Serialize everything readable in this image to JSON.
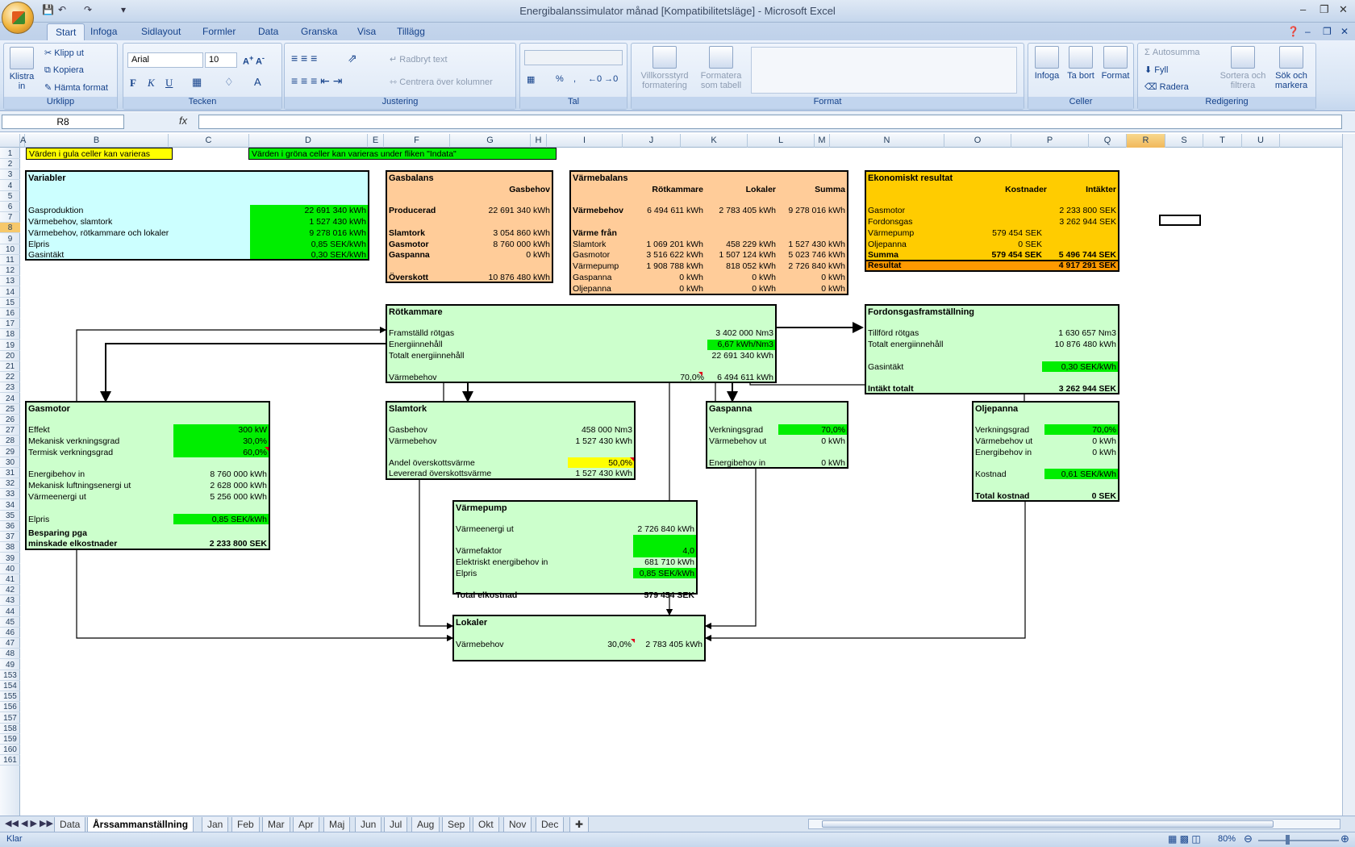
{
  "window": {
    "title": "Energibalanssimulator månad  [Kompatibilitetsläge] - Microsoft Excel"
  },
  "ribbon": {
    "tabs": [
      "Start",
      "Infoga",
      "Sidlayout",
      "Formler",
      "Data",
      "Granska",
      "Visa",
      "Tillägg"
    ],
    "clipboard": {
      "paste": "Klistra in",
      "cut": "Klipp ut",
      "copy": "Kopiera",
      "format_painter": "Hämta format",
      "title": "Urklipp"
    },
    "font": {
      "name": "Arial",
      "size": "10",
      "title": "Tecken",
      "bold": "F",
      "italic": "K",
      "underline": "U"
    },
    "alignment": {
      "wrap": "Radbryt text",
      "merge": "Centrera över kolumner",
      "title": "Justering"
    },
    "number": {
      "title": "Tal",
      "percent": "%"
    },
    "styles": {
      "cond_format": "Villkorsstyrd formatering",
      "format_table": "Formatera som tabell",
      "title": "Format"
    },
    "cells": {
      "insert": "Infoga",
      "delete": "Ta bort",
      "format": "Format",
      "title": "Celler"
    },
    "editing": {
      "autosum": "Autosumma",
      "fill": "Fyll",
      "clear": "Radera",
      "sort": "Sortera och filtrera",
      "find": "Sök och markera",
      "title": "Redigering"
    }
  },
  "formula_bar": {
    "name_box": "R8",
    "fx": "fx",
    "formula": ""
  },
  "columns": [
    "A",
    "B",
    "C",
    "D",
    "E",
    "F",
    "G",
    "H",
    "I",
    "J",
    "K",
    "L",
    "M",
    "N",
    "O",
    "P",
    "Q",
    "R",
    "S",
    "T",
    "U"
  ],
  "rows": [
    "1",
    "2",
    "3",
    "4",
    "5",
    "6",
    "7",
    "8",
    "9",
    "10",
    "11",
    "12",
    "13",
    "14",
    "15",
    "16",
    "17",
    "18",
    "19",
    "20",
    "21",
    "22",
    "23",
    "24",
    "25",
    "26",
    "27",
    "28",
    "29",
    "30",
    "31",
    "32",
    "33",
    "34",
    "35",
    "36",
    "37",
    "38",
    "39",
    "40",
    "41",
    "42",
    "43",
    "44",
    "45",
    "46",
    "47",
    "48",
    "49",
    "153",
    "154",
    "155",
    "156",
    "157",
    "158",
    "159",
    "160",
    "161"
  ],
  "notes": {
    "yellow": "Värden i gula celler kan varieras",
    "green": "Värden i gröna celler kan varieras under fliken \"Indata\""
  },
  "variabler": {
    "title": "Variabler",
    "rows": [
      {
        "label": "Gasproduktion",
        "value": "22 691 340 kWh"
      },
      {
        "label": "Värmebehov, slamtork",
        "value": "1 527 430 kWh"
      },
      {
        "label": "Värmebehov, rötkammare och lokaler",
        "value": "9 278 016 kWh"
      },
      {
        "label": "Elpris",
        "value": "0,85 SEK/kWh"
      },
      {
        "label": "Gasintäkt",
        "value": "0,30 SEK/kWh"
      }
    ]
  },
  "gasbalans": {
    "title": "Gasbalans",
    "col": "Gasbehov",
    "producerad_label": "Producerad",
    "producerad": "22 691 340 kWh",
    "rows": [
      {
        "label": "Slamtork",
        "value": "3 054 860 kWh"
      },
      {
        "label": "Gasmotor",
        "value": "8 760 000 kWh"
      },
      {
        "label": "Gaspanna",
        "value": "0 kWh"
      }
    ],
    "overskott_label": "Överskott",
    "overskott": "10 876 480 kWh"
  },
  "varmebalans": {
    "title": "Värmebalans",
    "cols": [
      "Rötkammare",
      "Lokaler",
      "Summa"
    ],
    "behov": {
      "label": "Värmebehov",
      "values": [
        "6 494 611 kWh",
        "2 783 405 kWh",
        "9 278 016 kWh"
      ]
    },
    "fran_label": "Värme från",
    "rows": [
      {
        "label": "Slamtork",
        "values": [
          "1 069 201 kWh",
          "458 229 kWh",
          "1 527 430 kWh"
        ]
      },
      {
        "label": "Gasmotor",
        "values": [
          "3 516 622 kWh",
          "1 507 124 kWh",
          "5 023 746 kWh"
        ]
      },
      {
        "label": "Värmepump",
        "values": [
          "1 908 788 kWh",
          "818 052 kWh",
          "2 726 840 kWh"
        ]
      },
      {
        "label": "Gaspanna",
        "values": [
          "0 kWh",
          "0 kWh",
          "0 kWh"
        ]
      },
      {
        "label": "Oljepanna",
        "values": [
          "0 kWh",
          "0 kWh",
          "0 kWh"
        ]
      }
    ]
  },
  "ekonomi": {
    "title": "Ekonomiskt resultat",
    "cols": [
      "Kostnader",
      "Intäkter"
    ],
    "rows": [
      {
        "label": "Gasmotor",
        "cost": "",
        "income": "2 233 800 SEK"
      },
      {
        "label": "Fordonsgas",
        "cost": "",
        "income": "3 262 944 SEK"
      },
      {
        "label": "Värmepump",
        "cost": "579 454 SEK",
        "income": ""
      },
      {
        "label": "Oljepanna",
        "cost": "0 SEK",
        "income": ""
      },
      {
        "label": "Summa",
        "cost": "579 454 SEK",
        "income": "5 496 744 SEK"
      }
    ],
    "result_label": "Resultat",
    "result": "4 917 291 SEK"
  },
  "rotkammare": {
    "title": "Rötkammare",
    "rows": [
      {
        "label": "Framställd rötgas",
        "value": "3 402 000 Nm3"
      },
      {
        "label": "Energiinnehåll",
        "value": "6,67 kWh/Nm3"
      },
      {
        "label": "Totalt energiinnehåll",
        "value": "22 691 340 kWh"
      }
    ],
    "behov_label": "Värmebehov",
    "behov_pct": "70,0%",
    "behov": "6 494 611 kWh"
  },
  "fordonsgas": {
    "title": "Fordonsgasframställning",
    "rows": [
      {
        "label": "Tillförd rötgas",
        "value": "1 630 657 Nm3"
      },
      {
        "label": "Totalt energiinnehåll",
        "value": "10 876 480 kWh"
      }
    ],
    "intakt_label": "Gasintäkt",
    "intakt": "0,30 SEK/kWh",
    "total_label": "Intäkt totalt",
    "total": "3 262 944 SEK"
  },
  "gasmotor": {
    "title": "Gasmotor",
    "inputs": [
      {
        "label": "Effekt",
        "value": "300 kW"
      },
      {
        "label": "Mekanisk verkningsgrad",
        "value": "30,0%"
      },
      {
        "label": "Termisk verkningsgrad",
        "value": "60,0%"
      }
    ],
    "rows": [
      {
        "label": "Energibehov in",
        "value": "8 760 000 kWh"
      },
      {
        "label": "Mekanisk luftningsenergi ut",
        "value": "2 628 000 kWh"
      },
      {
        "label": "Värmeenergi ut",
        "value": "5 256 000 kWh"
      }
    ],
    "elpris_label": "Elpris",
    "elpris": "0,85 SEK/kWh",
    "besparing_label1": "Besparing pga",
    "besparing_label2": "minskade elkostnader",
    "besparing": "2 233 800 SEK"
  },
  "slamtork": {
    "title": "Slamtork",
    "rows": [
      {
        "label": "Gasbehov",
        "value": "458 000 Nm3"
      },
      {
        "label": "Värmebehov",
        "value": "1 527 430 kWh"
      }
    ],
    "andel_label": "Andel överskottsvärme",
    "andel": "50,0%",
    "lev_label": "Levererad överskottsvärme",
    "lev": "1 527 430 kWh"
  },
  "gaspanna": {
    "title": "Gaspanna",
    "rows": [
      {
        "label": "Verkningsgrad",
        "value": "70,0%"
      },
      {
        "label": "Värmebehov ut",
        "value": "0 kWh"
      }
    ],
    "in_label": "Energibehov in",
    "in": "0 kWh"
  },
  "oljepanna": {
    "title": "Oljepanna",
    "rows": [
      {
        "label": "Verkningsgrad",
        "value": "70,0%"
      },
      {
        "label": "Värmebehov ut",
        "value": "0 kWh"
      },
      {
        "label": "Energibehov in",
        "value": "0 kWh"
      }
    ],
    "kostnad_label": "Kostnad",
    "kostnad": "0,61 SEK/kWh",
    "total_label": "Total kostnad",
    "total": "0 SEK"
  },
  "varmepump": {
    "title": "Värmepump",
    "ut_label": "Värmeenergi ut",
    "ut": "2 726 840 kWh",
    "faktor_label": "Värmefaktor",
    "faktor": "4,0",
    "el_label": "Elektriskt energibehov in",
    "el": "681 710 kWh",
    "elpris_label": "Elpris",
    "elpris": "0,85 SEK/kWh",
    "total_label": "Total elkostnad",
    "total": "579 454 SEK"
  },
  "lokaler": {
    "title": "Lokaler",
    "label": "Värmebehov",
    "pct": "30,0%",
    "value": "2 783 405 kWh"
  },
  "sheet_tabs": [
    "Data",
    "Årssammanställning",
    "Jan",
    "Feb",
    "Mar",
    "Apr",
    "Maj",
    "Jun",
    "Jul",
    "Aug",
    "Sep",
    "Okt",
    "Nov",
    "Dec"
  ],
  "status": {
    "ready": "Klar",
    "zoom": "80%"
  }
}
